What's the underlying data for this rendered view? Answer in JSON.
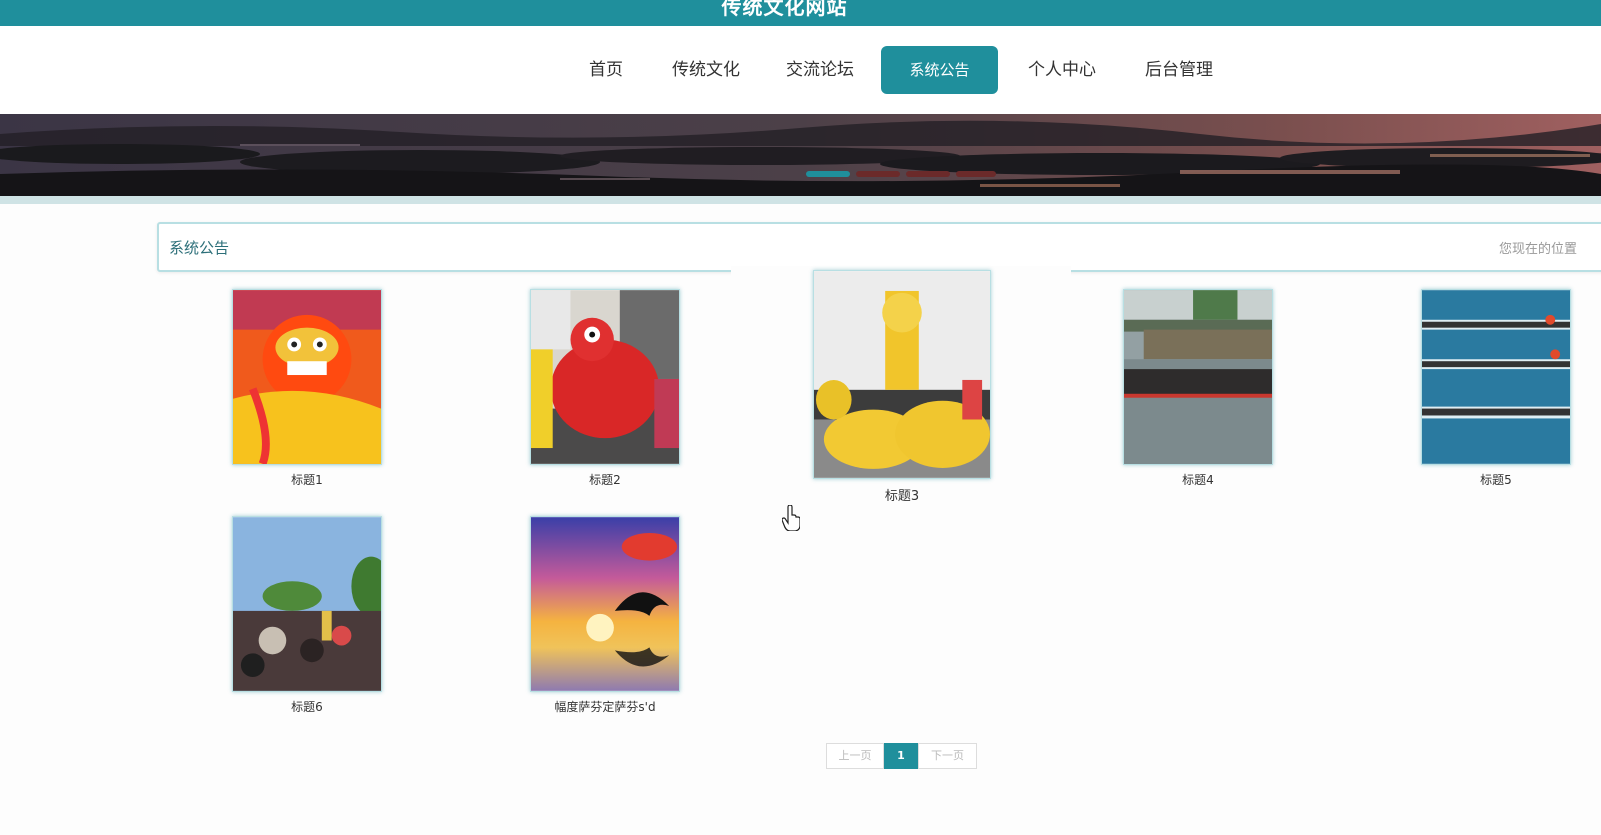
{
  "header": {
    "site_title": "传统文化网站"
  },
  "nav": {
    "items": [
      {
        "label": "首页"
      },
      {
        "label": "传统文化"
      },
      {
        "label": "交流论坛"
      },
      {
        "label": "系统公告",
        "active": true
      },
      {
        "label": "个人中心"
      },
      {
        "label": "后台管理"
      }
    ]
  },
  "banner": {
    "slides": 4,
    "active_slide": 1
  },
  "section": {
    "title": "系统公告",
    "breadcrumb": "您现在的位置"
  },
  "notices": [
    {
      "caption": "标题1",
      "image": "lion-dance-red-mask"
    },
    {
      "caption": "标题2",
      "image": "lion-dance-red-street"
    },
    {
      "caption": "标题3",
      "image": "lion-dance-yellow"
    },
    {
      "caption": "标题4",
      "image": "dragon-boat-river"
    },
    {
      "caption": "标题5",
      "image": "dragon-boats-race"
    },
    {
      "caption": "标题6",
      "image": "festival-crowd"
    },
    {
      "caption": "幅度萨芬定萨芬s'd",
      "image": "dolphin-sunset"
    }
  ],
  "pagination": {
    "prev": "上一页",
    "current": "1",
    "next": "下一页"
  },
  "colors": {
    "accent": "#1f8f9c",
    "border": "#b8dfe3"
  }
}
